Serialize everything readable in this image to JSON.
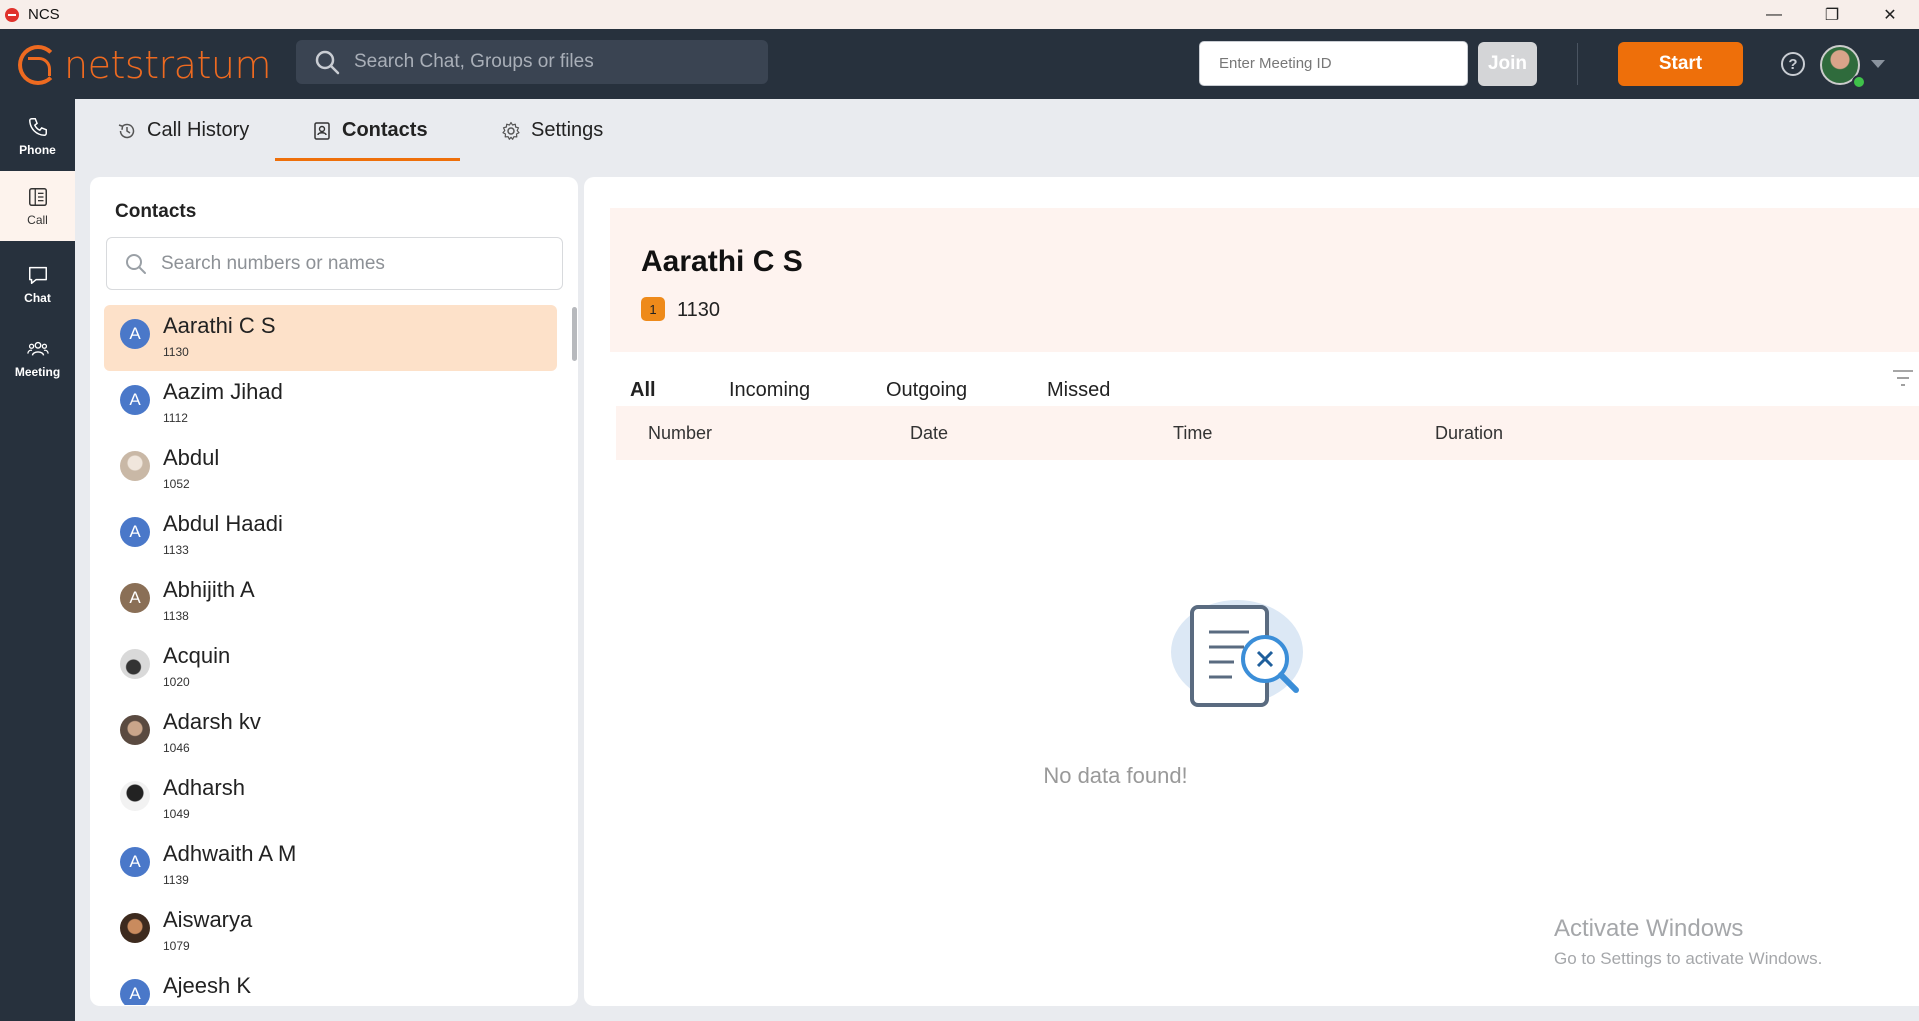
{
  "titlebar": {
    "app_title": "NCS",
    "minimize": "—",
    "restore": "❐",
    "close": "✕"
  },
  "header": {
    "logo_text": "netstratum",
    "search_placeholder": "Search Chat, Groups or files",
    "meeting_id_placeholder": "Enter Meeting ID",
    "join_label": "Join",
    "start_label": "Start",
    "help_glyph": "?",
    "accent_color": "#ee6f0a"
  },
  "rail": {
    "items": [
      {
        "label": "Phone",
        "icon": "phone-icon"
      },
      {
        "label": "Call",
        "icon": "call-log-icon",
        "active": true
      },
      {
        "label": "Chat",
        "icon": "chat-bubble-icon"
      },
      {
        "label": "Meeting",
        "icon": "people-icon"
      }
    ]
  },
  "tabs": [
    {
      "label": "Call History",
      "icon": "history-icon"
    },
    {
      "label": "Contacts",
      "icon": "contact-book-icon",
      "active": true
    },
    {
      "label": "Settings",
      "icon": "gear-icon"
    }
  ],
  "contacts": {
    "title": "Contacts",
    "search_placeholder": "Search numbers or names",
    "list": [
      {
        "name": "Aarathi C S",
        "ext": "1130",
        "initial": "A",
        "avatar_color": "#4a78c9",
        "selected": true
      },
      {
        "name": "Aazim Jihad",
        "ext": "1112",
        "initial": "A",
        "avatar_color": "#4a78c9"
      },
      {
        "name": "Abdul",
        "ext": "1052",
        "initial": "",
        "avatar_color": "#d8cfc4"
      },
      {
        "name": "Abdul Haadi",
        "ext": "1133",
        "initial": "A",
        "avatar_color": "#4a78c9"
      },
      {
        "name": "Abhijith A",
        "ext": "1138",
        "initial": "A",
        "avatar_color": "#8a6f56"
      },
      {
        "name": "Acquin",
        "ext": "1020",
        "initial": "",
        "avatar_color": "#9a9a9a"
      },
      {
        "name": "Adarsh kv",
        "ext": "1046",
        "initial": "",
        "avatar_color": "#6b5a4e"
      },
      {
        "name": "Adharsh",
        "ext": "1049",
        "initial": "",
        "avatar_color": "#2b2b2b"
      },
      {
        "name": "Adhwaith A M",
        "ext": "1139",
        "initial": "A",
        "avatar_color": "#4a78c9"
      },
      {
        "name": "Aiswarya",
        "ext": "1079",
        "initial": "",
        "avatar_color": "#8b5e3c"
      },
      {
        "name": "Ajeesh K",
        "ext": "",
        "initial": "A",
        "avatar_color": "#4a78c9"
      }
    ]
  },
  "detail": {
    "name": "Aarathi C S",
    "badge": "1",
    "ext": "1130",
    "filters": [
      "All",
      "Incoming",
      "Outgoing",
      "Missed"
    ],
    "columns": [
      "Number",
      "Date",
      "Time",
      "Duration"
    ],
    "empty_text": "No data found!"
  },
  "watermark": {
    "line1": "Activate Windows",
    "line2": "Go to Settings to activate Windows."
  }
}
